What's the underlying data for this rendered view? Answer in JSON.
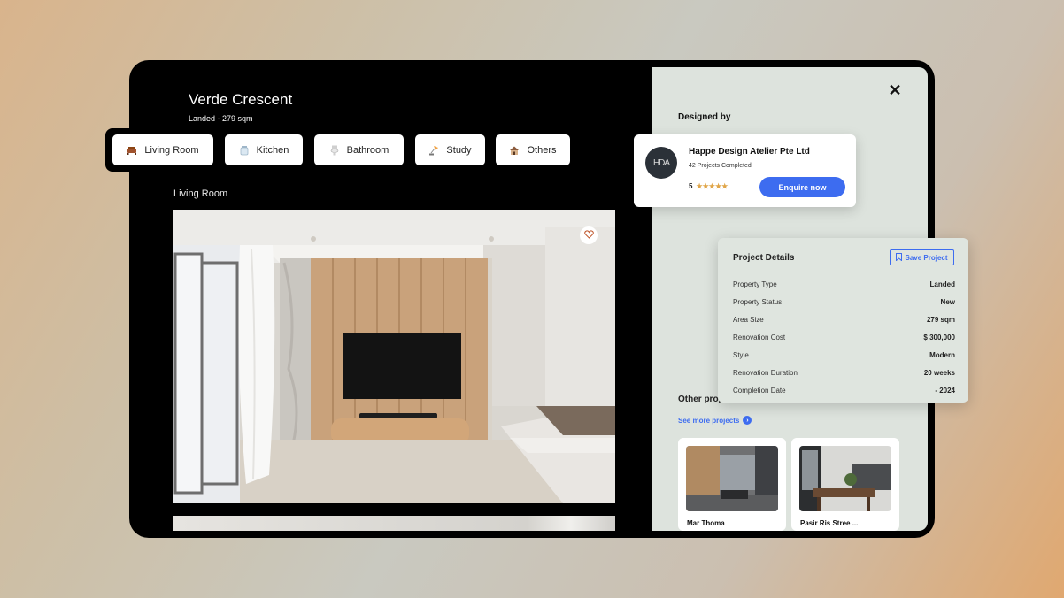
{
  "project": {
    "title": "Verde Crescent",
    "subtitle": "Landed - 279 sqm",
    "current_room": "Living Room"
  },
  "tabs": [
    {
      "label": "Living Room",
      "icon": "sofa-icon",
      "active": true
    },
    {
      "label": "Kitchen",
      "icon": "jar-icon",
      "active": false
    },
    {
      "label": "Bathroom",
      "icon": "toilet-icon",
      "active": false
    },
    {
      "label": "Study",
      "icon": "desk-lamp-icon",
      "active": false
    },
    {
      "label": "Others",
      "icon": "house-icon",
      "active": false
    }
  ],
  "designer": {
    "section_label": "Designed by",
    "logo_text": "HDA",
    "name": "Happe Design Atelier Pte Ltd",
    "projects_completed": "42 Projects Completed",
    "rating": "5",
    "stars": "★★★★★",
    "enquire_label": "Enquire now"
  },
  "details": {
    "title": "Project Details",
    "save_label": "Save Project",
    "rows": [
      {
        "label": "Property Type",
        "value": "Landed"
      },
      {
        "label": "Property Status",
        "value": "New"
      },
      {
        "label": "Area Size",
        "value": "279 sqm"
      },
      {
        "label": "Renovation Cost",
        "value": "$ 300,000"
      },
      {
        "label": "Style",
        "value": "Modern"
      },
      {
        "label": "Renovation Duration",
        "value": "20 weeks"
      },
      {
        "label": "Completion Date",
        "value": "- 2024"
      }
    ]
  },
  "other_projects": {
    "title": "Other projects by this designer",
    "see_more": "See more projects",
    "items": [
      {
        "name": "Mar Thoma"
      },
      {
        "name": "Pasir Ris Stree ..."
      }
    ]
  },
  "colors": {
    "accent": "#3d6cf0",
    "star": "#e0a548",
    "panel": "#dde3dd"
  }
}
